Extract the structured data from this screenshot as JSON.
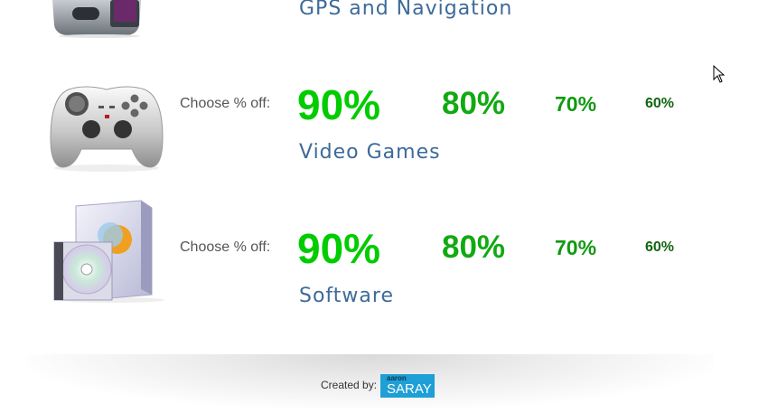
{
  "categories": [
    {
      "name": "GPS and Navigation",
      "icon": "gps-device-icon"
    },
    {
      "name": "Video Games",
      "icon": "gamepad-icon",
      "choose_label": "Choose % off:",
      "options": [
        "90%",
        "80%",
        "70%",
        "60%"
      ]
    },
    {
      "name": "Software",
      "icon": "software-box-icon",
      "choose_label": "Choose % off:",
      "options": [
        "90%",
        "80%",
        "70%",
        "60%"
      ]
    }
  ],
  "footer": {
    "created_by": "Created by:",
    "logo_small": "aaron",
    "logo_big": "SARAY"
  },
  "colors": {
    "title": "#3d6a99",
    "pct90": "#00cc00",
    "pct80": "#11aa11",
    "pct70": "#119911",
    "pct60": "#116611",
    "logo_bg": "#1e9fd6"
  }
}
